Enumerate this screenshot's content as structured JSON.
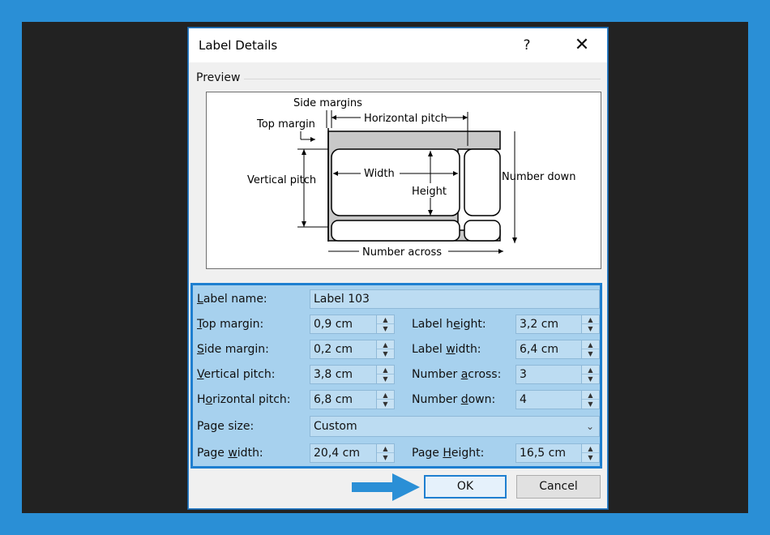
{
  "dialog": {
    "title": "Label Details",
    "help_glyph": "?",
    "close_glyph": "✕"
  },
  "preview": {
    "group_label": "Preview",
    "diagram_labels": {
      "side_margins": "Side margins",
      "horizontal_pitch": "Horizontal pitch",
      "top_margin": "Top margin",
      "vertical_pitch": "Vertical pitch",
      "width": "Width",
      "height": "Height",
      "number_down": "Number down",
      "number_across": "Number across"
    }
  },
  "form": {
    "label_name": {
      "label": "Label name:",
      "ul": "L",
      "rest": "abel name:",
      "value": "Label 103"
    },
    "top_margin": {
      "ul": "T",
      "rest": "op margin:",
      "value": "0,9 cm"
    },
    "side_margin": {
      "ul": "S",
      "rest": "ide margin:",
      "value": "0,2 cm"
    },
    "vertical_pitch": {
      "ul": "V",
      "rest": "ertical pitch:",
      "value": "3,8 cm"
    },
    "horizontal_pitch": {
      "pre": "H",
      "ul": "o",
      "rest": "rizontal pitch:",
      "value": "6,8 cm"
    },
    "label_height": {
      "pre": "Label h",
      "ul": "e",
      "rest": "ight:",
      "value": "3,2 cm"
    },
    "label_width": {
      "pre": "Label ",
      "ul": "w",
      "rest": "idth:",
      "value": "6,4 cm"
    },
    "number_across": {
      "pre": "Number ",
      "ul": "a",
      "rest": "cross:",
      "value": "3"
    },
    "number_down": {
      "pre": "Number ",
      "ul": "d",
      "rest": "own:",
      "value": "4"
    },
    "page_size": {
      "label": "Page size:",
      "value": "Custom"
    },
    "page_width": {
      "pre": "Page ",
      "ul": "w",
      "rest": "idth:",
      "value": "20,4 cm"
    },
    "page_height": {
      "pre": "Page ",
      "ul": "H",
      "rest": "eight:",
      "value": "16,5 cm"
    }
  },
  "buttons": {
    "ok": "OK",
    "cancel": "Cancel"
  },
  "colors": {
    "highlight_border": "#1e7fd0",
    "highlight_fill": "#a7d1ee",
    "outer_frame": "#2a8fd6"
  }
}
